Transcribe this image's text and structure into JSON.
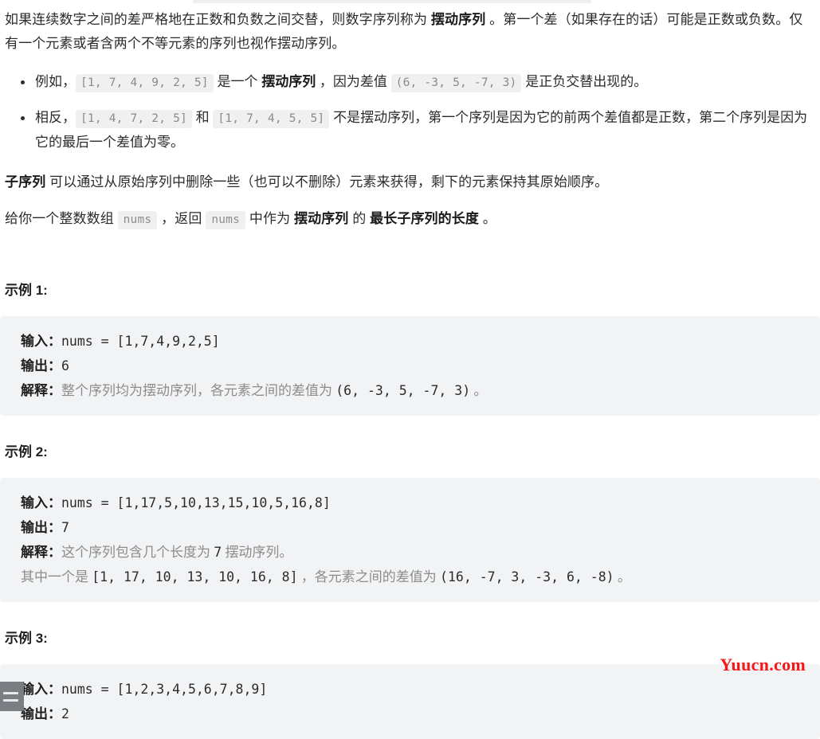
{
  "document": {
    "intro": {
      "p1_before_bold": "如果连续数字之间的差严格地在正数和负数之间交替，则数字序列称为 ",
      "p1_bold": "摆动序列",
      "p1_after_bold": " 。第一个差（如果存在的话）可能是正数或负数。仅有一个元素或者含两个不等元素的序列也视作摆动序列。"
    },
    "bullets": [
      {
        "t1": "例如，",
        "code1": "[1, 7, 4, 9, 2, 5]",
        "t2": " 是一个 ",
        "bold1": "摆动序列",
        "t3": " ，因为差值 ",
        "code2": "(6, -3, 5, -7, 3)",
        "t4": " 是正负交替出现的。"
      },
      {
        "t1": "相反，",
        "code1": "[1, 4, 7, 2, 5]",
        "t2": " 和 ",
        "code2": "[1, 7, 4, 5, 5]",
        "t3": " 不是摆动序列，第一个序列是因为它的前两个差值都是正数，第二个序列是因为它的最后一个差值为零。"
      }
    ],
    "subsequence_para": {
      "bold": "子序列",
      "rest": " 可以通过从原始序列中删除一些（也可以不删除）元素来获得，剩下的元素保持其原始顺序。"
    },
    "task_para": {
      "t1": "给你一个整数数组 ",
      "code1": "nums",
      "t2": " ，返回 ",
      "code2": "nums",
      "t3": " 中作为 ",
      "bold1": "摆动序列",
      "t4": " 的 ",
      "bold2": "最长子序列的长度",
      "t5": " 。"
    },
    "examples": [
      {
        "title": "示例 1:",
        "input_label": "输入：",
        "input_value": "nums = [1,7,4,9,2,5]",
        "output_label": "输出：",
        "output_value": "6",
        "explain_label": "解释：",
        "explain_value": "整个序列均为摆动序列，各元素之间的差值为 ",
        "explain_mono": "(6, -3, 5, -7, 3)",
        "explain_tail": " 。",
        "extra_line_prefix": "",
        "extra_line_mono": "",
        "extra_line_mid": "",
        "extra_line_mono2": "",
        "extra_line_tail": ""
      },
      {
        "title": "示例 2:",
        "input_label": "输入：",
        "input_value": "nums = [1,17,5,10,13,15,10,5,16,8]",
        "output_label": "输出：",
        "output_value": "7",
        "explain_label": "解释：",
        "explain_value": "这个序列包含几个长度为 ",
        "explain_mono": "7",
        "explain_tail": " 摆动序列。",
        "extra_line_prefix": "其中一个是 ",
        "extra_line_mono": "[1, 17, 10, 13, 10, 16, 8]",
        "extra_line_mid": " ，各元素之间的差值为 ",
        "extra_line_mono2": "(16, -7, 3, -3, 6, -8)",
        "extra_line_tail": " 。"
      },
      {
        "title": "示例 3:",
        "input_label": "输入：",
        "input_value": "nums = [1,2,3,4,5,6,7,8,9]",
        "output_label": "输出：",
        "output_value": "2",
        "explain_label": "",
        "explain_value": "",
        "explain_mono": "",
        "explain_tail": "",
        "extra_line_prefix": "",
        "extra_line_mono": "",
        "extra_line_mid": "",
        "extra_line_mono2": "",
        "extra_line_tail": ""
      }
    ]
  },
  "watermark": {
    "text": "Yuucn.com",
    "color": "#f51818"
  },
  "drawer_handle": {
    "icon": "hamburger-menu-icon"
  },
  "colors": {
    "example_box_bg": "#f2f3f5",
    "inline_code_bg": "#f0f0f0",
    "inline_code_text": "#8a8a8a",
    "body_text": "#2b2b2b",
    "muted_text": "#8c8c8c"
  }
}
